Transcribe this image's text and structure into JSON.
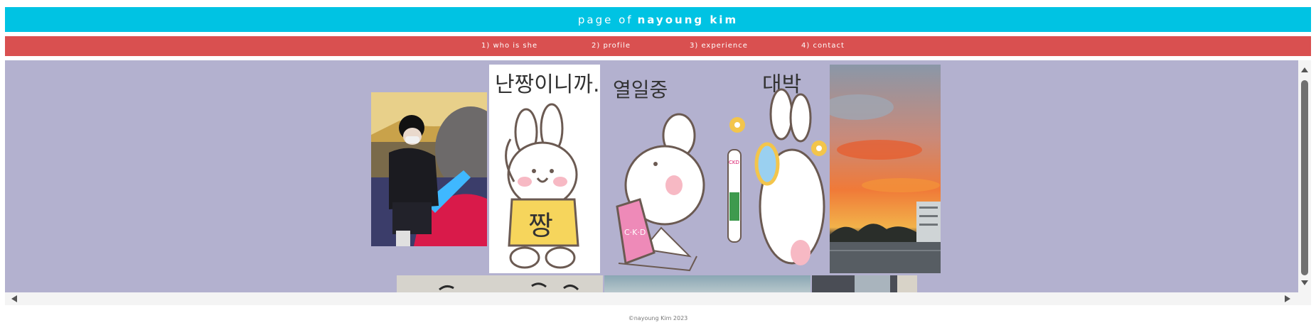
{
  "header": {
    "prefix": "page of",
    "name": "nayoung kim"
  },
  "nav": {
    "items": [
      {
        "label": "1) who is she"
      },
      {
        "label": "2) profile"
      },
      {
        "label": "3) experience"
      },
      {
        "label": "4) contact"
      }
    ]
  },
  "gallery": {
    "sticker_1_text": "난짱이니까..!",
    "sticker_1_shirt": "짱",
    "sticker_2_text": "열일중",
    "sticker_2_laptop": "C·K·D",
    "sticker_3_text": "대박",
    "sticker_3_bottle": "CKD"
  },
  "footer": {
    "copyright": "©nayoung Kim 2023"
  },
  "colors": {
    "header_bg": "#00c3e3",
    "nav_bg": "#d95050",
    "gallery_bg": "#b3b1cf"
  }
}
